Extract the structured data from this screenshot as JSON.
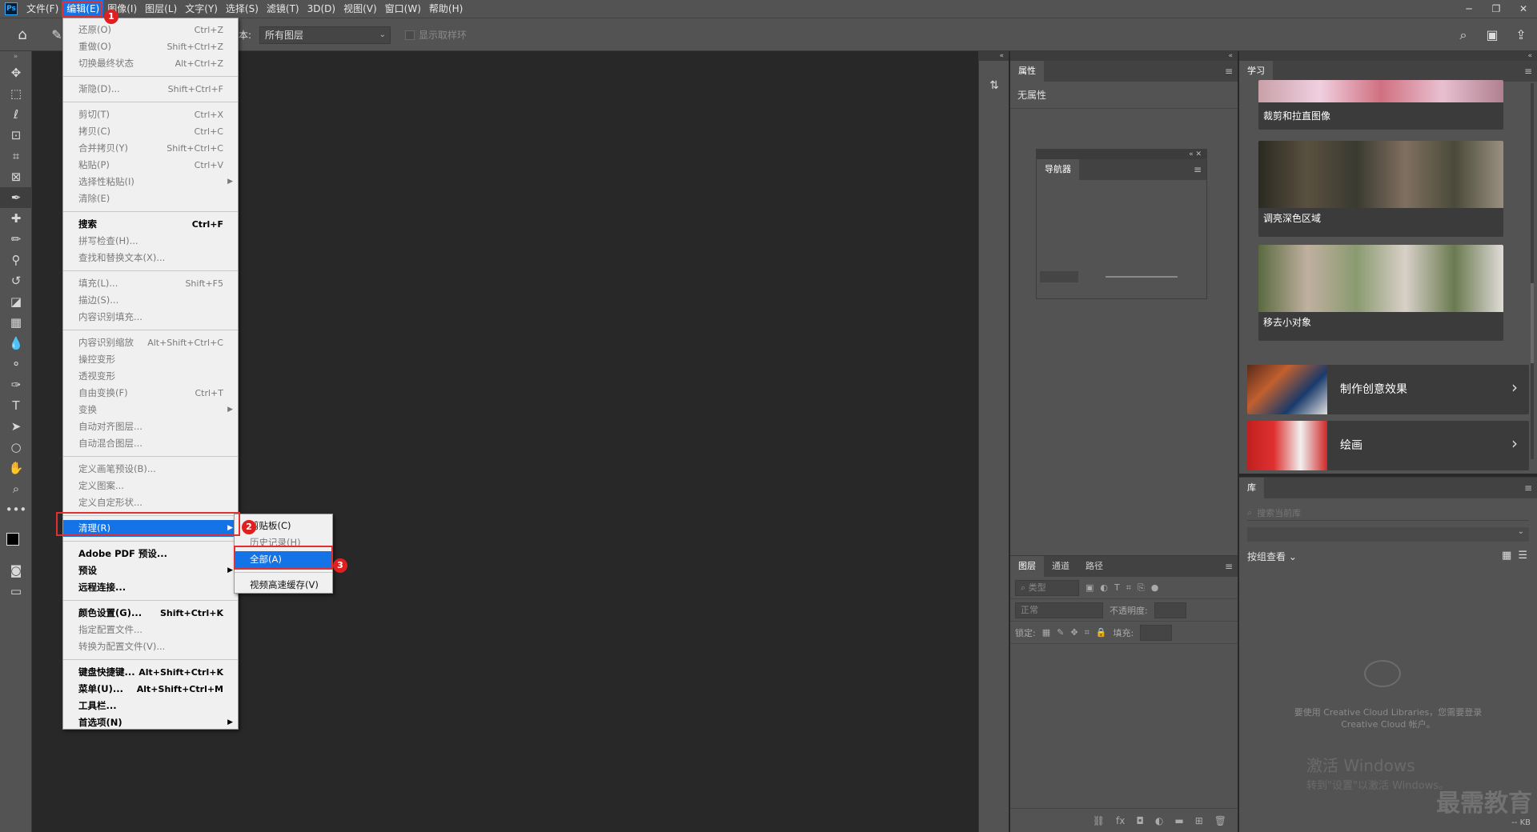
{
  "menubar": {
    "logo": "Ps",
    "items": [
      "文件(F)",
      "编辑(E)",
      "图像(I)",
      "图层(L)",
      "文字(Y)",
      "选择(S)",
      "滤镜(T)",
      "3D(D)",
      "视图(V)",
      "窗口(W)",
      "帮助(H)"
    ],
    "active_index": 1
  },
  "optionsbar": {
    "sample_label": "本:",
    "sample_value": "所有图层",
    "show_ring": "显示取样环"
  },
  "edit_menu": {
    "items": [
      {
        "label": "还原(O)",
        "shortcut": "Ctrl+Z",
        "disabled": true
      },
      {
        "label": "重做(O)",
        "shortcut": "Shift+Ctrl+Z",
        "disabled": true
      },
      {
        "label": "切换最终状态",
        "shortcut": "Alt+Ctrl+Z",
        "disabled": true
      },
      {
        "sep": true
      },
      {
        "label": "渐隐(D)...",
        "shortcut": "Shift+Ctrl+F",
        "disabled": true
      },
      {
        "sep": true
      },
      {
        "label": "剪切(T)",
        "shortcut": "Ctrl+X",
        "disabled": true
      },
      {
        "label": "拷贝(C)",
        "shortcut": "Ctrl+C",
        "disabled": true
      },
      {
        "label": "合并拷贝(Y)",
        "shortcut": "Shift+Ctrl+C",
        "disabled": true
      },
      {
        "label": "粘贴(P)",
        "shortcut": "Ctrl+V",
        "disabled": true
      },
      {
        "label": "选择性粘贴(I)",
        "shortcut": "",
        "disabled": true,
        "submenu": true
      },
      {
        "label": "清除(E)",
        "shortcut": "",
        "disabled": true
      },
      {
        "sep": true
      },
      {
        "label": "搜索",
        "shortcut": "Ctrl+F",
        "bold": true
      },
      {
        "label": "拼写检查(H)...",
        "shortcut": "",
        "disabled": true
      },
      {
        "label": "查找和替换文本(X)...",
        "shortcut": "",
        "disabled": true
      },
      {
        "sep": true
      },
      {
        "label": "填充(L)...",
        "shortcut": "Shift+F5",
        "disabled": true
      },
      {
        "label": "描边(S)...",
        "shortcut": "",
        "disabled": true
      },
      {
        "label": "内容识别填充...",
        "shortcut": "",
        "disabled": true
      },
      {
        "sep": true
      },
      {
        "label": "内容识别缩放",
        "shortcut": "Alt+Shift+Ctrl+C",
        "disabled": true
      },
      {
        "label": "操控变形",
        "shortcut": "",
        "disabled": true
      },
      {
        "label": "透视变形",
        "shortcut": "",
        "disabled": true
      },
      {
        "label": "自由变换(F)",
        "shortcut": "Ctrl+T",
        "disabled": true
      },
      {
        "label": "变换",
        "shortcut": "",
        "disabled": true,
        "submenu": true
      },
      {
        "label": "自动对齐图层...",
        "shortcut": "",
        "disabled": true
      },
      {
        "label": "自动混合图层...",
        "shortcut": "",
        "disabled": true
      },
      {
        "sep": true
      },
      {
        "label": "定义画笔预设(B)...",
        "shortcut": "",
        "disabled": true
      },
      {
        "label": "定义图案...",
        "shortcut": "",
        "disabled": true
      },
      {
        "label": "定义自定形状...",
        "shortcut": "",
        "disabled": true
      },
      {
        "sep": true
      },
      {
        "label": "清理(R)",
        "shortcut": "",
        "highlight": true,
        "submenu": true
      },
      {
        "sep": true
      },
      {
        "label": "Adobe PDF 预设...",
        "shortcut": "",
        "bold": true
      },
      {
        "label": "预设",
        "shortcut": "",
        "bold": true,
        "submenu": true
      },
      {
        "label": "远程连接...",
        "shortcut": "",
        "bold": true
      },
      {
        "sep": true
      },
      {
        "label": "颜色设置(G)...",
        "shortcut": "Shift+Ctrl+K",
        "bold": true
      },
      {
        "label": "指定配置文件...",
        "shortcut": "",
        "disabled": true
      },
      {
        "label": "转换为配置文件(V)...",
        "shortcut": "",
        "disabled": true
      },
      {
        "sep": true
      },
      {
        "label": "键盘快捷键...",
        "shortcut": "Alt+Shift+Ctrl+K",
        "bold": true
      },
      {
        "label": "菜单(U)...",
        "shortcut": "Alt+Shift+Ctrl+M",
        "bold": true
      },
      {
        "label": "工具栏...",
        "shortcut": "",
        "bold": true
      },
      {
        "label": "首选项(N)",
        "shortcut": "",
        "bold": true,
        "submenu": true
      }
    ]
  },
  "purge_submenu": {
    "items": [
      {
        "label": "剪贴板(C)",
        "disabled": false
      },
      {
        "label": "历史记录(H)",
        "disabled": true
      },
      {
        "label": "全部(A)",
        "highlight": true
      },
      {
        "sep": true
      },
      {
        "label": "视频高速缓存(V)",
        "disabled": false
      }
    ]
  },
  "annotations": {
    "badge1": "1",
    "badge2": "2",
    "badge3": "3",
    "color": "#e03030"
  },
  "properties_panel": {
    "tab": "属性",
    "empty_text": "无属性"
  },
  "navigator_panel": {
    "tab": "导航器"
  },
  "layers_panel": {
    "tabs": [
      "图层",
      "通道",
      "路径"
    ],
    "filter_placeholder": "类型",
    "blend_mode": "正常",
    "opacity_label": "不透明度:",
    "lock_label": "锁定:",
    "fill_label": "填充:"
  },
  "learn_panel": {
    "tab": "学习",
    "cards": [
      "裁剪和拉直图像",
      "调亮深色区域",
      "移去小对象"
    ],
    "rows": [
      "制作创意效果",
      "绘画"
    ]
  },
  "libraries_panel": {
    "tab": "库",
    "search_placeholder": "搜索当前库",
    "group_by": "按组查看",
    "message": "要使用 Creative Cloud Libraries，您需要登录 Creative Cloud 帐户。",
    "watermark_title": "激活 Windows",
    "watermark_sub": "转到\"设置\"以激活 Windows。",
    "brand": "最需教育",
    "footer": "-- KB"
  },
  "colors": {
    "accent": "#1473e6",
    "panel": "#535353",
    "canvas": "#282828"
  }
}
